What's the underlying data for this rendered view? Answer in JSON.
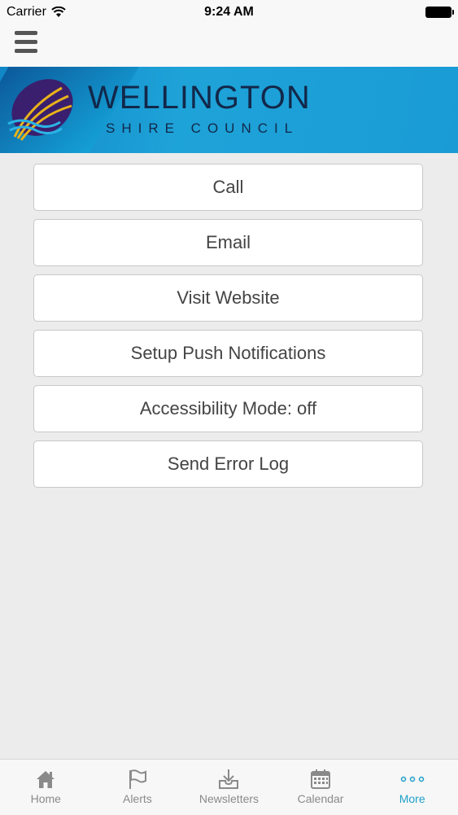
{
  "status_bar": {
    "carrier": "Carrier",
    "time": "9:24 AM"
  },
  "banner": {
    "title": "WELLINGTON",
    "subtitle": "SHIRE COUNCIL"
  },
  "menu": {
    "items": [
      {
        "label": "Call"
      },
      {
        "label": "Email"
      },
      {
        "label": "Visit Website"
      },
      {
        "label": "Setup Push Notifications"
      },
      {
        "label": "Accessibility Mode: off"
      },
      {
        "label": "Send Error Log"
      }
    ]
  },
  "tab_bar": {
    "tabs": [
      {
        "label": "Home",
        "icon": "home-icon"
      },
      {
        "label": "Alerts",
        "icon": "flag-icon"
      },
      {
        "label": "Newsletters",
        "icon": "inbox-icon"
      },
      {
        "label": "Calendar",
        "icon": "calendar-icon"
      },
      {
        "label": "More",
        "icon": "more-dots-icon"
      }
    ],
    "active": "More",
    "active_color": "#1fa0c8"
  }
}
